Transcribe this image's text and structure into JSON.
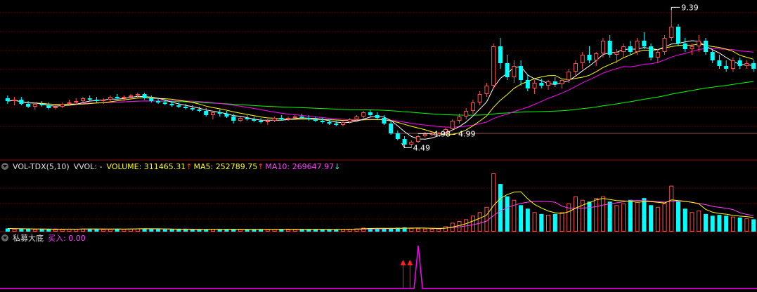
{
  "chart_data": [
    {
      "type": "candlestick",
      "title": "",
      "price_labels": {
        "high": "9.39",
        "low": "4.49",
        "range": "4.98 - 4.99"
      },
      "ma_colors": {
        "ma5": "#ffffff",
        "ma10": "#ffff00",
        "ma20": "#ff00ff",
        "ma60": "#00ff00"
      },
      "up_color": "#ff5050",
      "down_color": "#00ffff",
      "flat_line": 5.0,
      "ylim": [
        4.2,
        9.6
      ],
      "candles": [
        [
          6.25,
          6.35,
          6.05,
          6.15
        ],
        [
          6.15,
          6.3,
          6.0,
          6.2
        ],
        [
          6.2,
          6.3,
          6.0,
          6.05
        ],
        [
          6.05,
          6.15,
          5.9,
          5.95
        ],
        [
          5.95,
          6.1,
          5.85,
          6.05
        ],
        [
          6.05,
          6.15,
          5.95,
          6.0
        ],
        [
          6.0,
          6.1,
          5.85,
          5.9
        ],
        [
          5.9,
          6.0,
          5.85,
          5.95
        ],
        [
          5.95,
          6.1,
          5.9,
          6.05
        ],
        [
          6.05,
          6.2,
          6.0,
          6.1
        ],
        [
          6.1,
          6.25,
          6.0,
          6.15
        ],
        [
          6.15,
          6.3,
          6.1,
          6.25
        ],
        [
          6.25,
          6.35,
          6.15,
          6.2
        ],
        [
          6.2,
          6.3,
          6.1,
          6.15
        ],
        [
          6.15,
          6.25,
          6.05,
          6.2
        ],
        [
          6.2,
          6.35,
          6.1,
          6.3
        ],
        [
          6.3,
          6.4,
          6.2,
          6.25
        ],
        [
          6.25,
          6.35,
          6.15,
          6.3
        ],
        [
          6.3,
          6.4,
          6.2,
          6.35
        ],
        [
          6.35,
          6.45,
          6.25,
          6.4
        ],
        [
          6.4,
          6.45,
          6.2,
          6.25
        ],
        [
          6.25,
          6.35,
          6.1,
          6.15
        ],
        [
          6.15,
          6.25,
          6.05,
          6.1
        ],
        [
          6.1,
          6.2,
          6.0,
          6.05
        ],
        [
          6.05,
          6.15,
          5.95,
          6.0
        ],
        [
          6.0,
          6.1,
          5.9,
          5.95
        ],
        [
          5.95,
          6.05,
          5.85,
          5.9
        ],
        [
          5.9,
          6.0,
          5.8,
          5.85
        ],
        [
          5.85,
          5.95,
          5.75,
          5.8
        ],
        [
          5.8,
          5.9,
          5.6,
          5.65
        ],
        [
          5.65,
          5.8,
          5.5,
          5.75
        ],
        [
          5.75,
          5.85,
          5.6,
          5.7
        ],
        [
          5.7,
          5.8,
          5.55,
          5.6
        ],
        [
          5.6,
          5.7,
          5.35,
          5.45
        ],
        [
          5.45,
          5.6,
          5.4,
          5.55
        ],
        [
          5.55,
          5.65,
          5.45,
          5.5
        ],
        [
          5.5,
          5.6,
          5.4,
          5.45
        ],
        [
          5.45,
          5.55,
          5.35,
          5.4
        ],
        [
          5.4,
          5.5,
          5.3,
          5.45
        ],
        [
          5.45,
          5.6,
          5.4,
          5.55
        ],
        [
          5.55,
          5.65,
          5.45,
          5.5
        ],
        [
          5.5,
          5.6,
          5.45,
          5.55
        ],
        [
          5.55,
          5.65,
          5.5,
          5.6
        ],
        [
          5.6,
          5.7,
          5.5,
          5.55
        ],
        [
          5.55,
          5.65,
          5.45,
          5.5
        ],
        [
          5.5,
          5.6,
          5.4,
          5.45
        ],
        [
          5.45,
          5.55,
          5.35,
          5.4
        ],
        [
          5.4,
          5.5,
          5.3,
          5.35
        ],
        [
          5.35,
          5.45,
          5.25,
          5.3
        ],
        [
          5.3,
          5.45,
          5.25,
          5.4
        ],
        [
          5.4,
          5.55,
          5.35,
          5.5
        ],
        [
          5.5,
          5.65,
          5.45,
          5.6
        ],
        [
          5.6,
          5.8,
          5.55,
          5.75
        ],
        [
          5.75,
          5.85,
          5.6,
          5.65
        ],
        [
          5.65,
          5.75,
          5.5,
          5.55
        ],
        [
          5.55,
          5.65,
          5.3,
          5.35
        ],
        [
          5.35,
          5.45,
          4.95,
          5.0
        ],
        [
          5.0,
          5.1,
          4.75,
          4.8
        ],
        [
          4.8,
          4.9,
          4.49,
          4.6
        ],
        [
          4.6,
          4.75,
          4.5,
          4.7
        ],
        [
          4.7,
          4.95,
          4.65,
          4.9
        ],
        [
          4.9,
          5.05,
          4.85,
          4.98
        ],
        [
          4.98,
          5.05,
          4.9,
          4.99
        ],
        [
          4.99,
          5.05,
          4.95,
          5.02
        ],
        [
          5.02,
          5.2,
          4.98,
          5.15
        ],
        [
          5.15,
          5.5,
          5.1,
          5.45
        ],
        [
          5.45,
          5.7,
          5.35,
          5.6
        ],
        [
          5.6,
          5.9,
          5.5,
          5.8
        ],
        [
          5.8,
          6.2,
          5.7,
          6.1
        ],
        [
          6.1,
          6.5,
          6.0,
          6.4
        ],
        [
          6.4,
          6.8,
          6.3,
          6.7
        ],
        [
          6.7,
          8.2,
          6.6,
          8.1
        ],
        [
          8.1,
          8.4,
          7.3,
          7.5
        ],
        [
          7.5,
          7.8,
          6.9,
          7.0
        ],
        [
          7.0,
          7.6,
          6.8,
          7.4
        ],
        [
          7.4,
          7.6,
          6.7,
          6.9
        ],
        [
          6.9,
          7.1,
          6.5,
          6.6
        ],
        [
          6.6,
          6.9,
          6.4,
          6.8
        ],
        [
          6.8,
          6.95,
          6.6,
          6.7
        ],
        [
          6.7,
          6.9,
          6.55,
          6.85
        ],
        [
          6.85,
          7.0,
          6.65,
          6.75
        ],
        [
          6.75,
          6.95,
          6.6,
          6.9
        ],
        [
          6.9,
          7.3,
          6.8,
          7.2
        ],
        [
          7.2,
          7.6,
          7.0,
          7.5
        ],
        [
          7.5,
          7.9,
          7.3,
          7.8
        ],
        [
          7.8,
          8.1,
          7.5,
          7.6
        ],
        [
          7.6,
          7.9,
          7.4,
          7.85
        ],
        [
          7.85,
          8.4,
          7.7,
          8.3
        ],
        [
          8.3,
          8.5,
          7.7,
          7.8
        ],
        [
          7.8,
          8.0,
          7.5,
          7.9
        ],
        [
          7.9,
          8.2,
          7.7,
          8.1
        ],
        [
          8.1,
          8.3,
          7.8,
          7.9
        ],
        [
          7.9,
          8.4,
          7.8,
          8.3
        ],
        [
          8.3,
          8.6,
          8.0,
          8.1
        ],
        [
          8.1,
          8.2,
          7.6,
          7.7
        ],
        [
          7.7,
          8.0,
          7.5,
          7.9
        ],
        [
          7.9,
          8.5,
          7.8,
          8.4
        ],
        [
          8.4,
          9.39,
          8.3,
          8.8
        ],
        [
          8.8,
          8.9,
          8.1,
          8.2
        ],
        [
          8.2,
          8.4,
          7.9,
          8.0
        ],
        [
          8.0,
          8.2,
          7.8,
          8.1
        ],
        [
          8.1,
          8.5,
          7.9,
          8.3
        ],
        [
          8.3,
          8.4,
          7.8,
          7.9
        ],
        [
          7.9,
          8.0,
          7.5,
          7.6
        ],
        [
          7.6,
          7.8,
          7.3,
          7.4
        ],
        [
          7.4,
          7.6,
          7.2,
          7.3
        ],
        [
          7.3,
          7.7,
          7.2,
          7.6
        ],
        [
          7.6,
          7.7,
          7.3,
          7.4
        ],
        [
          7.4,
          7.6,
          7.3,
          7.5
        ],
        [
          7.5,
          7.6,
          7.2,
          7.3
        ]
      ]
    },
    {
      "type": "bar",
      "legend": {
        "indicator": "VOL-TDX(5,10)",
        "vvol": "VVOL: -",
        "volume": "VOLUME: 311465.31",
        "ma5": "MA5: 252789.75",
        "ma10": "MA10: 269647.97"
      },
      "legend_colors": {
        "indicator": "#e0e0e0",
        "volume": "#ffff00",
        "ma5": "#ffff00",
        "ma10": "#ff40ff",
        "up_arrow": "#ff4040",
        "down_arrow": "#40ffff"
      },
      "ylim": [
        0,
        330000
      ],
      "values": [
        18000,
        16000,
        15000,
        14000,
        13000,
        15000,
        14000,
        12000,
        13000,
        16000,
        15000,
        17000,
        16000,
        14000,
        13000,
        14000,
        16000,
        15000,
        17000,
        18000,
        17000,
        15000,
        14000,
        13000,
        12000,
        13000,
        12000,
        11000,
        12000,
        14000,
        15000,
        13000,
        12000,
        14000,
        13000,
        12000,
        11000,
        12000,
        13000,
        14000,
        13000,
        12000,
        13000,
        14000,
        13000,
        12000,
        11000,
        12000,
        12000,
        14000,
        16000,
        18000,
        22000,
        20000,
        18000,
        17000,
        19000,
        22000,
        24000,
        20000,
        18000,
        17000,
        16000,
        17000,
        30000,
        50000,
        60000,
        70000,
        90000,
        110000,
        140000,
        330000,
        270000,
        200000,
        180000,
        150000,
        130000,
        110000,
        100000,
        95000,
        100000,
        110000,
        160000,
        200000,
        180000,
        170000,
        190000,
        200000,
        170000,
        150000,
        160000,
        180000,
        170000,
        190000,
        150000,
        140000,
        160000,
        260000,
        170000,
        130000,
        110000,
        120000,
        100000,
        90000,
        95000,
        90000,
        85000,
        80000,
        75000,
        70000
      ]
    },
    {
      "type": "line",
      "legend": {
        "title": "私募大底",
        "buy": "买入: 0.00"
      },
      "legend_colors": {
        "title": "#e0e0e0",
        "buy": "#ff40ff",
        "line": "#ff00ff",
        "signal": "#ff2020"
      },
      "signal_days": [
        58,
        59
      ],
      "spike_day": 60,
      "ylim": [
        0,
        1
      ]
    }
  ]
}
